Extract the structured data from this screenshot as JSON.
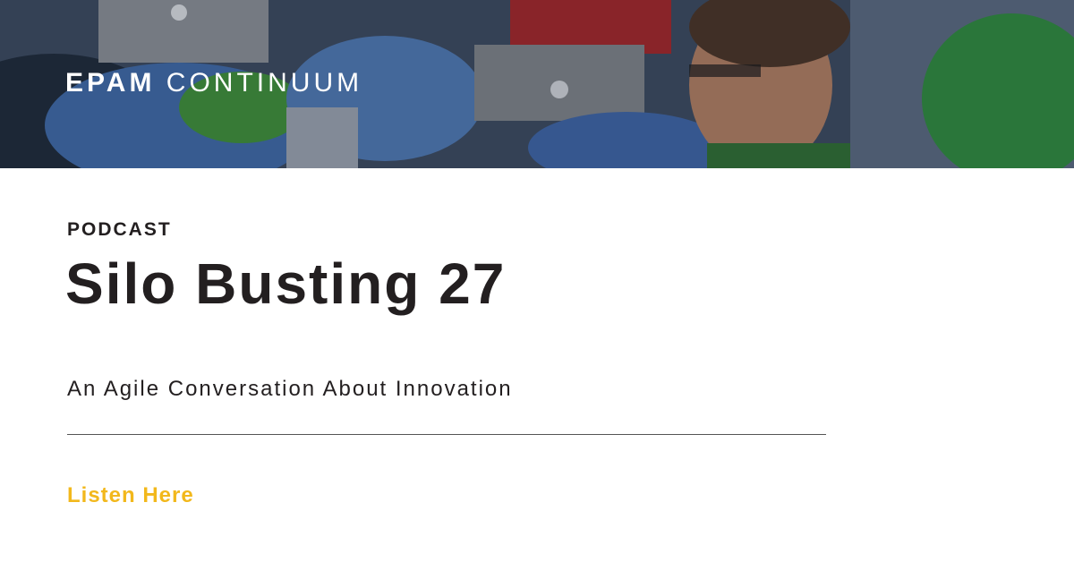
{
  "banner": {
    "photo": "people-with-laptops-on-beanbags",
    "logo": {
      "bold": "EPAM",
      "light": "CONTINUUM"
    }
  },
  "content": {
    "kicker": "PODCAST",
    "title": "Silo Busting 27",
    "subtitle": "An Agile Conversation About Innovation",
    "cta_label": "Listen Here"
  },
  "colors": {
    "text": "#231f20",
    "accent": "#f2b81c",
    "divider": "#555555",
    "background": "#ffffff"
  }
}
